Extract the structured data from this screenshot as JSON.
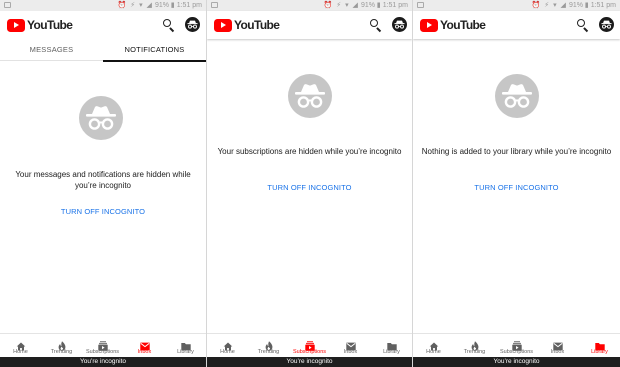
{
  "status_bar": {
    "battery": "91%",
    "time": "1:51 pm"
  },
  "logo_text": "YouTube",
  "colors": {
    "brand_red": "#ff0000",
    "link_blue": "#1a73e8",
    "incognito_grey": "#c6c6c6"
  },
  "screens": [
    {
      "tabs": [
        {
          "label": "MESSAGES",
          "active": false
        },
        {
          "label": "NOTIFICATIONS",
          "active": true
        }
      ],
      "message": "Your messages and notifications are hidden while you’re incognito",
      "action": "TURN OFF INCOGNITO",
      "active_nav": "Inbox"
    },
    {
      "message": "Your subscriptions are hidden while you’re incognito",
      "action": "TURN OFF INCOGNITO",
      "active_nav": "Subscriptions"
    },
    {
      "message": "Nothing is added to your library while you’re incognito",
      "action": "TURN OFF INCOGNITO",
      "active_nav": "Library"
    }
  ],
  "bottom_nav": [
    {
      "label": "Home",
      "icon": "home-icon"
    },
    {
      "label": "Trending",
      "icon": "flame-icon"
    },
    {
      "label": "Subscriptions",
      "icon": "subscriptions-icon"
    },
    {
      "label": "Inbox",
      "icon": "mail-icon"
    },
    {
      "label": "Library",
      "icon": "folder-icon"
    }
  ],
  "incognito_banner": "You’re incognito"
}
